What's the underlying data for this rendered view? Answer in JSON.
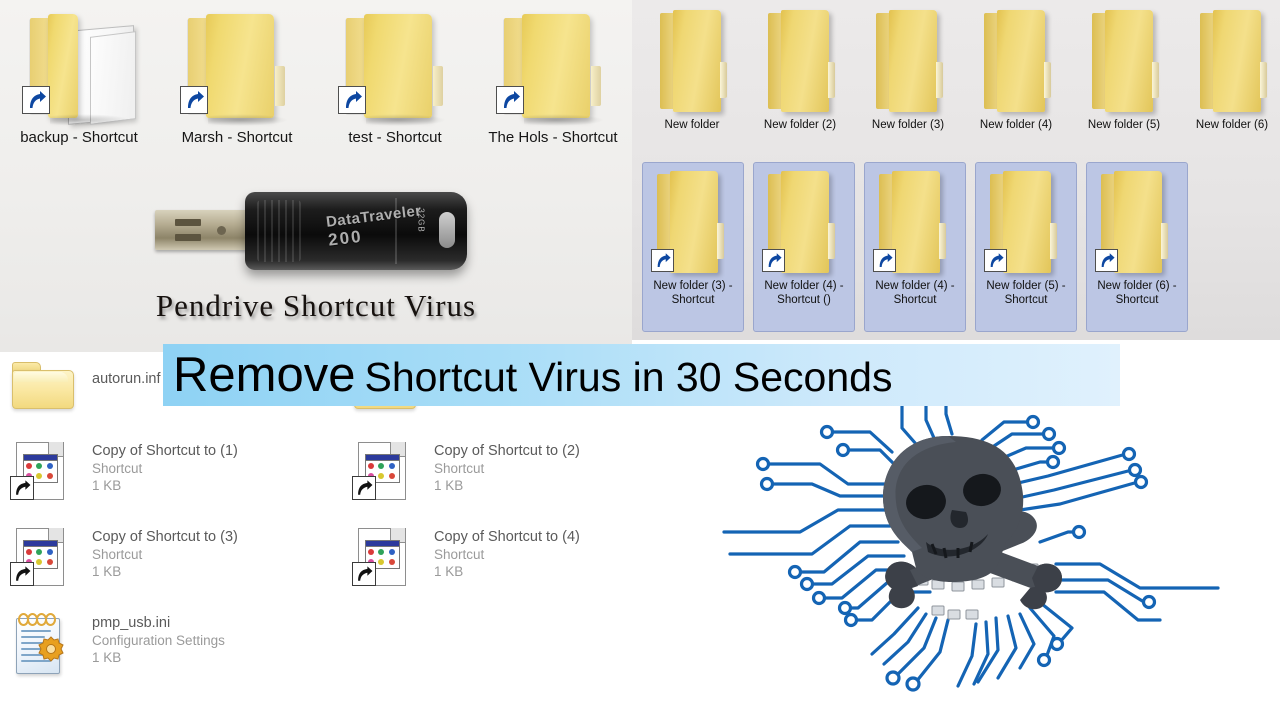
{
  "banner": {
    "lead_word": "Remove",
    "rest": "Shortcut Virus in 30 Seconds",
    "bg_left": "#8ed2f4",
    "bg_right": "#ddeffc"
  },
  "top_left_panel": {
    "caption": "Pendrive Shortcut  Virus",
    "device": {
      "brand": "DataTraveler",
      "model": "200",
      "capacity": "32GB"
    },
    "shortcuts": [
      {
        "label": "backup - Shortcut",
        "type": "folder-shortcut"
      },
      {
        "label": "Marsh - Shortcut",
        "type": "folder-shortcut"
      },
      {
        "label": "test - Shortcut",
        "type": "folder-shortcut"
      },
      {
        "label": "The Hols - Shortcut",
        "type": "folder-shortcut"
      }
    ]
  },
  "top_right_panel": {
    "folders": [
      {
        "label": "New folder"
      },
      {
        "label": "New folder (2)"
      },
      {
        "label": "New folder (3)"
      },
      {
        "label": "New folder (4)"
      },
      {
        "label": "New folder (5)"
      },
      {
        "label": "New folder (6)"
      }
    ],
    "shortcut_folders": [
      {
        "label": "New folder (3) - Shortcut",
        "selected": true
      },
      {
        "label": "New folder (4) - Shortcut ()",
        "selected": true
      },
      {
        "label": "New folder (4) - Shortcut",
        "selected": true
      },
      {
        "label": "New folder (5) - Shortcut",
        "selected": true
      },
      {
        "label": "New folder (6) - Shortcut",
        "selected": true
      }
    ],
    "selection_color": "#bcc6e4"
  },
  "file_list": {
    "column_1": [
      {
        "name": "autorun.inf",
        "type": "",
        "size": "",
        "icon": "folder-icon"
      },
      {
        "name": "Copy of Shortcut to (1)",
        "type": "Shortcut",
        "size": "1 KB",
        "icon": "shortcut-document-icon"
      },
      {
        "name": "Copy of Shortcut to (3)",
        "type": "Shortcut",
        "size": "1 KB",
        "icon": "shortcut-document-icon"
      },
      {
        "name": "pmp_usb.ini",
        "type": "Configuration Settings",
        "size": "1 KB",
        "icon": "configuration-file-icon"
      }
    ],
    "column_2": [
      {
        "name": "",
        "type": "",
        "size": "",
        "icon": "folder-icon"
      },
      {
        "name": "Copy of Shortcut to (2)",
        "type": "Shortcut",
        "size": "1 KB",
        "icon": "shortcut-document-icon"
      },
      {
        "name": "Copy of Shortcut to (4)",
        "type": "Shortcut",
        "size": "1 KB",
        "icon": "shortcut-document-icon"
      }
    ]
  },
  "artwork": {
    "name": "skull-crossbones-circuit",
    "skull_color": "#4a4f57",
    "trace_color": "#1464b4"
  }
}
